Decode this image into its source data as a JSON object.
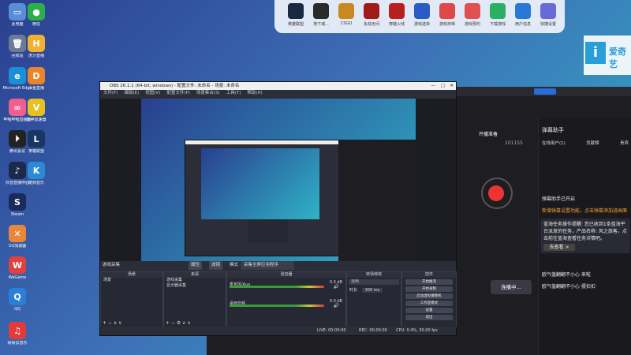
{
  "desktop_icons": [
    {
      "label": "此电脑",
      "color": "#5a8dd6",
      "glyph": "▭"
    },
    {
      "label": "回收站",
      "color": "#6c7a92",
      "glyph": "🗑"
    },
    {
      "label": "Microsoft Edge",
      "color": "#1b8fd8",
      "glyph": "e"
    },
    {
      "label": "哔哩哔哩直播姬",
      "color": "#ef5f8f",
      "glyph": "∞"
    },
    {
      "label": "腾讯会议",
      "color": "#222",
      "glyph": "⏵"
    },
    {
      "label": "抖音直播伴侣",
      "color": "#1a2a4a",
      "glyph": "♪"
    },
    {
      "label": "Steam",
      "color": "#1a2a5a",
      "glyph": "S"
    },
    {
      "label": "UU加速器",
      "color": "#e8863a",
      "glyph": "✕"
    },
    {
      "label": "WeGame",
      "color": "#e04040",
      "glyph": "W"
    },
    {
      "label": "QQ",
      "color": "#2a7fd6",
      "glyph": "Q"
    },
    {
      "label": "网易云音乐",
      "color": "#e33b3b",
      "glyph": "♫"
    },
    {
      "label": "微信",
      "color": "#2ab04a",
      "glyph": "●"
    },
    {
      "label": "虎牙直播",
      "color": "#f0b030",
      "glyph": "H"
    },
    {
      "label": "斗鱼直播",
      "color": "#e8852a",
      "glyph": "D"
    },
    {
      "label": "雷神加速器",
      "color": "#e8c020",
      "glyph": "V"
    },
    {
      "label": "英雄联盟",
      "color": "#1a3560",
      "glyph": "L"
    },
    {
      "label": "酷狗音乐",
      "color": "#2a8ad6",
      "glyph": "K"
    }
  ],
  "dock": [
    {
      "label": "英雄联盟",
      "color": "#1a2840"
    },
    {
      "label": "地下城...",
      "color": "#2a2a2a"
    },
    {
      "label": "CSGO",
      "color": "#c88a20"
    },
    {
      "label": "永劫无间",
      "color": "#a01a1a"
    },
    {
      "label": "穿越火线",
      "color": "#b82020"
    },
    {
      "label": "游戏选单",
      "color": "#2a5cc8"
    },
    {
      "label": "游戏存档",
      "color": "#e04848"
    },
    {
      "label": "游戏预约",
      "color": "#e05050"
    },
    {
      "label": "下载游戏",
      "color": "#2ab060"
    },
    {
      "label": "用户信息",
      "color": "#2a78d6"
    },
    {
      "label": "快捷设置",
      "color": "#6a6ad6"
    }
  ],
  "obs": {
    "title": "OBS 26.1.1 (64-bit, windows) - 配置文件: 未命名 - 场景: 未命名",
    "menu": [
      "文件(F)",
      "编辑(E)",
      "视图(V)",
      "配置文件(P)",
      "场景集合(S)",
      "工具(T)",
      "帮助(H)"
    ],
    "source_bar_label": "游戏采集",
    "props_btn": "属性",
    "filter_btn": "滤镜",
    "mode_label": "模式",
    "mode_value": "采集全屏应用程序",
    "panels": {
      "scenes": {
        "title": "场景",
        "items": [
          "场景"
        ]
      },
      "sources": {
        "title": "来源",
        "items": [
          "游戏采集",
          "显示器采集"
        ]
      },
      "mixer": {
        "title": "混音器",
        "tracks": [
          {
            "name": "桌面音频",
            "db": "0.0 dB"
          },
          {
            "name": "麦克风/Aux",
            "db": "0.0 dB"
          }
        ]
      },
      "transitions": {
        "title": "转场特效",
        "fade": "淡出",
        "duration_label": "时长",
        "duration_value": "300 ms"
      },
      "controls": {
        "title": "控件",
        "buttons": [
          "开始推流",
          "开始录制",
          "启动虚拟摄像机",
          "工作室模式",
          "设置",
          "退出"
        ]
      }
    },
    "status": {
      "live": "LIVE: 00:00:00",
      "rec": "REC: 00:00:00",
      "cpu": "CPU: 0.4%, 30.00 fps"
    }
  },
  "right_panel": {
    "title": "弹幕助手",
    "tabs": [
      "在线用户(1)",
      "贡献榜",
      "贵宾"
    ],
    "items": [
      "弹幕助手已开启",
      "新增弹幕设置功能，点击弹幕添加进画面",
      "蓝海任务操作提醒: 您已收到1条蓝海平台派发的任务，产品名称: 风之旅客，点击前往蓝海查看任务详情吧。",
      "欧气值翻翻不小心  来啦",
      "欧气值翻翻不小心  摆扣扣"
    ],
    "button": "去查看 >"
  },
  "bg_app": {
    "brand": "爱奇艺",
    "stream_btn": "连播中...",
    "start_label": "开播准备",
    "fans": "101155"
  }
}
